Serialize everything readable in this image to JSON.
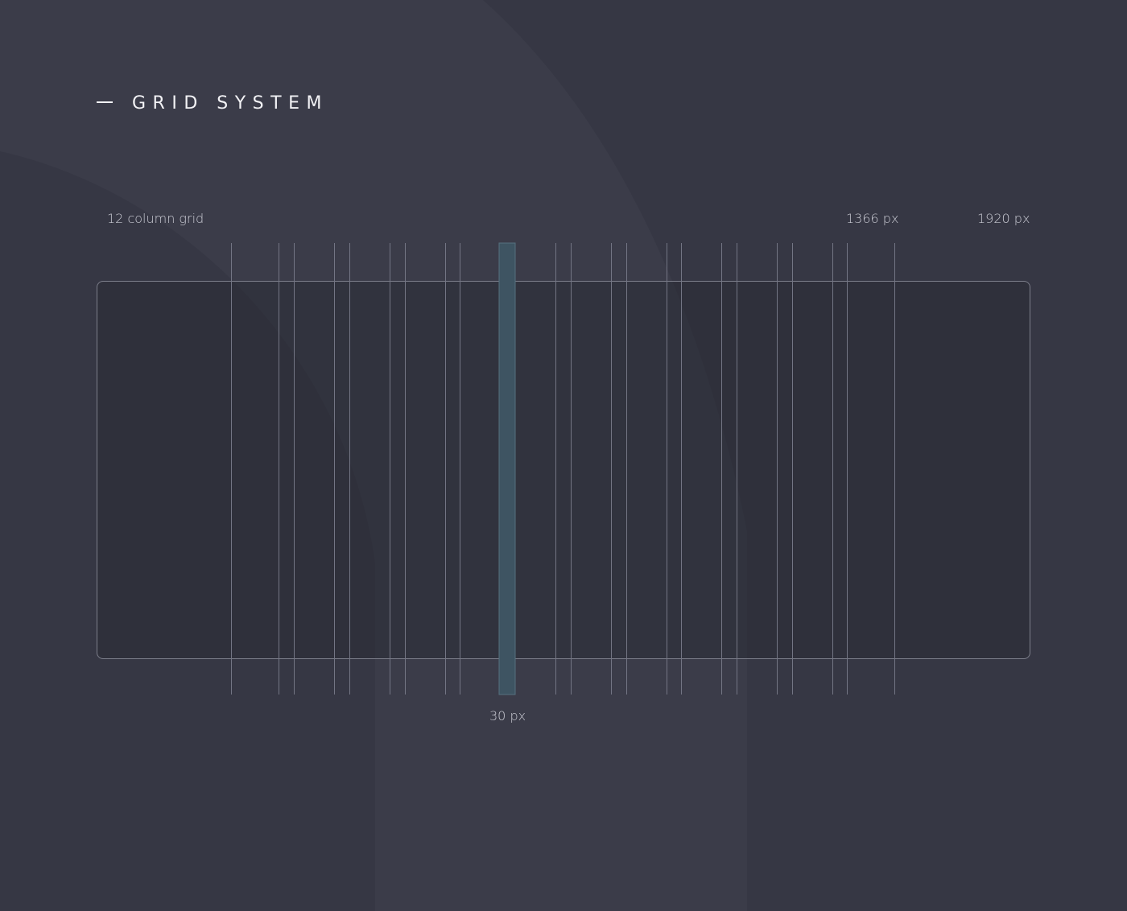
{
  "heading": {
    "title": "GRID SYSTEM"
  },
  "labels": {
    "columns": "12 column grid",
    "width_small": "1366 px",
    "width_large": "1920 px",
    "gutter": "30 px"
  },
  "colors": {
    "background": "#363744",
    "line": "#737584",
    "gutter_highlight": "#3e5462",
    "text": "#c9cad3",
    "heading": "#f2f2f5"
  }
}
